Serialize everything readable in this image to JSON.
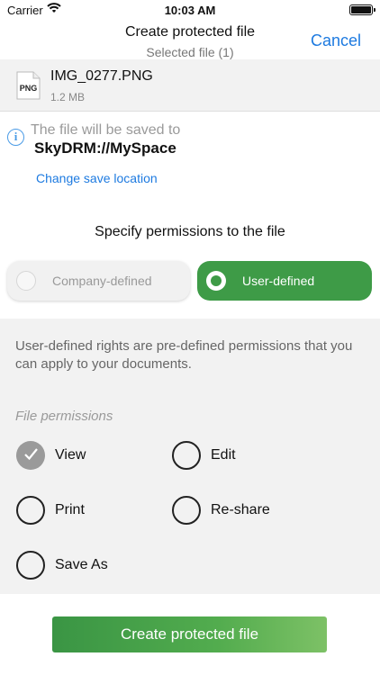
{
  "status_bar": {
    "carrier": "Carrier",
    "time": "10:03 AM"
  },
  "nav": {
    "title": "Create protected file",
    "subtitle": "Selected file (1)",
    "cancel_label": "Cancel"
  },
  "file": {
    "type_badge": "PNG",
    "name": "IMG_0277.PNG",
    "size": "1.2 MB"
  },
  "save": {
    "hint": "The file will be saved to",
    "path": "SkyDRM://MySpace",
    "change_label": "Change save location"
  },
  "permissions": {
    "heading": "Specify permissions to the file",
    "options": [
      {
        "label": "Company-defined",
        "selected": false
      },
      {
        "label": "User-defined",
        "selected": true
      }
    ],
    "description": "User-defined rights are pre-defined permissions that you can apply to your documents.",
    "file_permissions_label": "File permissions",
    "rights": [
      {
        "label": "View",
        "checked": true
      },
      {
        "label": "Edit",
        "checked": false
      },
      {
        "label": "Print",
        "checked": false
      },
      {
        "label": "Re-share",
        "checked": false
      },
      {
        "label": "Save As",
        "checked": false
      }
    ]
  },
  "create_button_label": "Create protected file",
  "colors": {
    "accent_blue": "#1d7ae0",
    "accent_green": "#3e9b47",
    "panel_gray": "#f2f2f2"
  }
}
